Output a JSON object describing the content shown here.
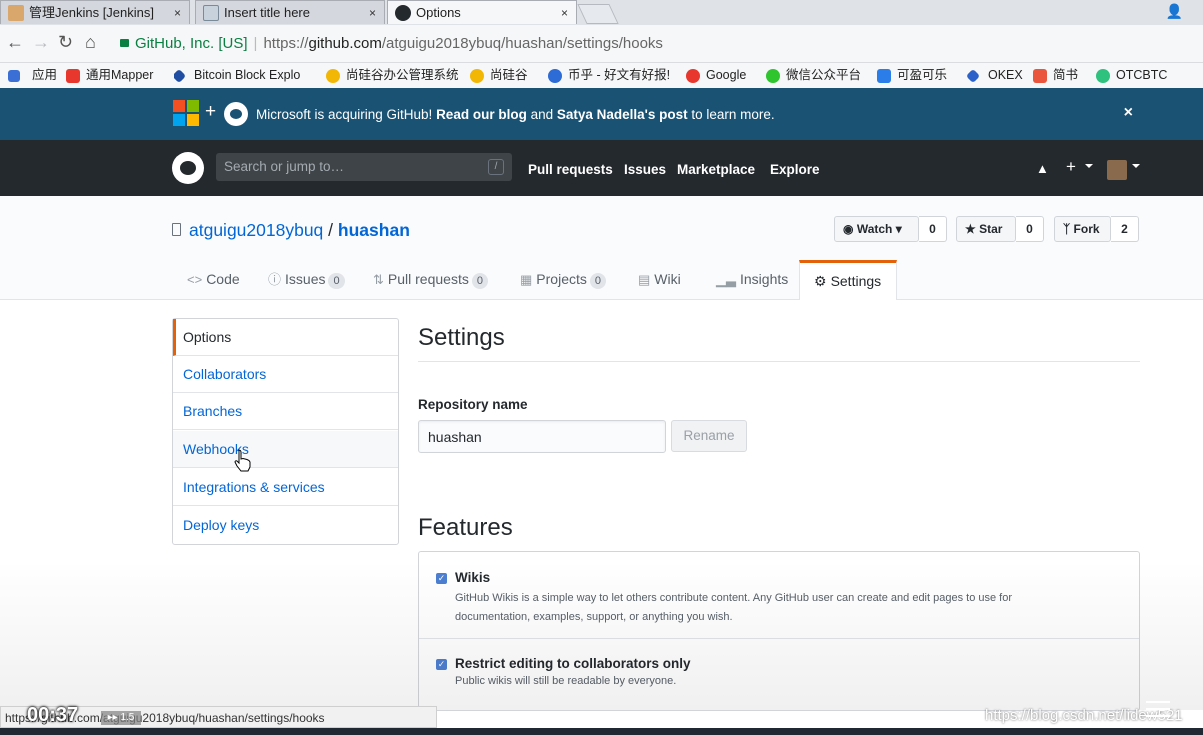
{
  "browser": {
    "tabs": [
      {
        "label": "管理Jenkins [Jenkins]",
        "close": "×"
      },
      {
        "label": "Insert title here",
        "close": "×"
      },
      {
        "label": "Options",
        "close": "×"
      }
    ],
    "address": {
      "secure_label": "GitHub, Inc. [US]",
      "url_prefix": "https://",
      "url_host": "github.com",
      "url_path": "/atguigu2018ybuq/huashan/settings/hooks"
    },
    "bookmarks": [
      {
        "label": "应用",
        "color": "#3b6fd6"
      },
      {
        "label": "通用Mapper",
        "color": "#e8372c"
      },
      {
        "label": "Bitcoin Block Explo",
        "color": "#1f4ea3"
      },
      {
        "label": "尚硅谷办公管理系统",
        "color": "#f2b705"
      },
      {
        "label": "尚硅谷",
        "color": "#f2b705"
      },
      {
        "label": "币乎 - 好文有好报!",
        "color": "#2d6bd6"
      },
      {
        "label": "Google",
        "color": "#e8372c"
      },
      {
        "label": "微信公众平台",
        "color": "#2ec52e"
      },
      {
        "label": "可盈可乐",
        "color": "#2b7de9"
      },
      {
        "label": "OKEX",
        "color": "#2b62c9"
      },
      {
        "label": "简书",
        "color": "#e9563d"
      },
      {
        "label": "OTCBTC",
        "color": "#2ec27e"
      }
    ]
  },
  "banner": {
    "text_start": "Microsoft is acquiring GitHub! ",
    "link1": "Read our blog",
    "text_mid": " and ",
    "link2": "Satya Nadella's post",
    "text_end": " to learn more.",
    "close": "×"
  },
  "header": {
    "search_placeholder": "Search or jump to…",
    "search_key": "/",
    "nav": [
      "Pull requests",
      "Issues",
      "Marketplace",
      "Explore"
    ]
  },
  "repo": {
    "owner": "atguigu2018ybuq",
    "sep": "/",
    "name": "huashan",
    "watch_label": "Watch",
    "watch_count": "0",
    "star_label": "Star",
    "star_count": "0",
    "fork_label": "Fork",
    "fork_count": "2",
    "tabs": [
      {
        "label": "Code",
        "icon": "<>"
      },
      {
        "label": "Issues",
        "count": "0"
      },
      {
        "label": "Pull requests",
        "count": "0"
      },
      {
        "label": "Projects",
        "count": "0"
      },
      {
        "label": "Wiki"
      },
      {
        "label": "Insights"
      },
      {
        "label": "Settings"
      }
    ]
  },
  "sidebar": {
    "items": [
      {
        "label": "Options"
      },
      {
        "label": "Collaborators"
      },
      {
        "label": "Branches"
      },
      {
        "label": "Webhooks"
      },
      {
        "label": "Integrations & services"
      },
      {
        "label": "Deploy keys"
      }
    ]
  },
  "settings": {
    "title": "Settings",
    "repo_name_label": "Repository name",
    "repo_name_value": "huashan",
    "rename_label": "Rename",
    "features_title": "Features",
    "features": [
      {
        "title": "Wikis",
        "desc_line1": "GitHub Wikis is a simple way to let others contribute content. Any GitHub user can create and edit pages to use for",
        "desc_line2": "documentation, examples, support, or anything you wish.",
        "checked": true
      },
      {
        "title": "Restrict editing to collaborators only",
        "desc_line1": "Public wikis will still be readable by everyone.",
        "checked": true
      }
    ]
  },
  "status_bar": {
    "url": "https://github.com/atguigu2018ybuq/huashan/settings/hooks"
  },
  "video_overlay": {
    "time": "00:37",
    "speed": "1.5",
    "watermark": "https://blog.csdn.net/lidew521"
  }
}
